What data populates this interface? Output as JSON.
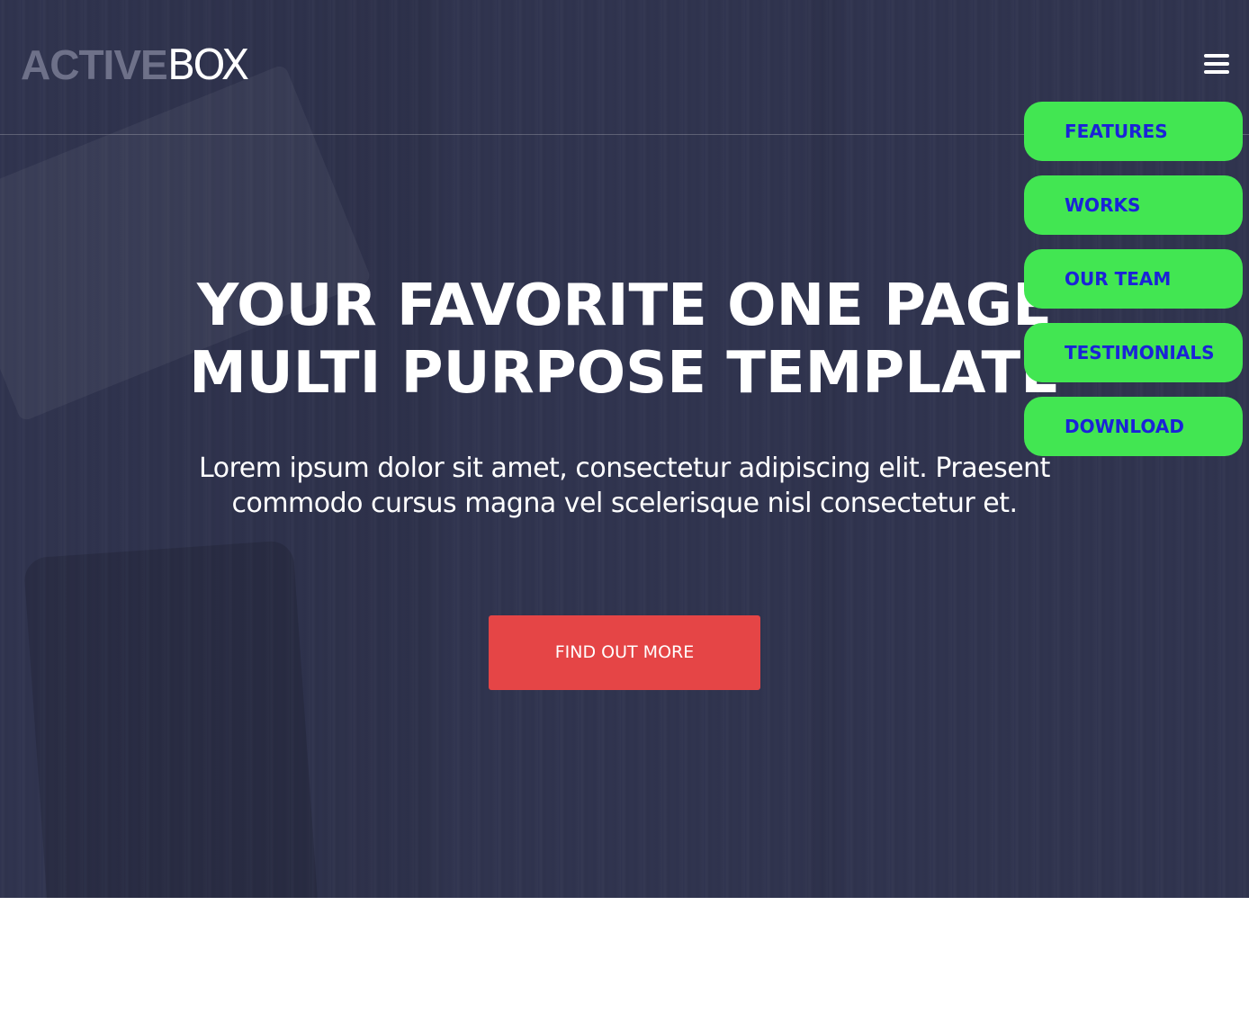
{
  "header": {
    "logo_part1": "ACTIVE",
    "logo_part2": "BOX",
    "menu_icon": "hamburger-menu-icon"
  },
  "menu": {
    "items": [
      {
        "label": "FEATURES"
      },
      {
        "label": "WORKS"
      },
      {
        "label": "OUR TEAM"
      },
      {
        "label": "TESTIMONIALS"
      },
      {
        "label": "DOWNLOAD"
      }
    ]
  },
  "hero": {
    "title_line1": "YOUR FAVORITE ONE PAGE",
    "title_line2": "MULTI PURPOSE TEMPLATE",
    "subtitle_line1": "Lorem ipsum dolor sit amet, consectetur adipiscing elit. Praesent",
    "subtitle_line2": "commodo cursus magna vel scelerisque nisl consectetur et.",
    "cta_label": "FIND OUT MORE"
  },
  "colors": {
    "hero_background": "#30344f",
    "menu_item_background": "#42e652",
    "menu_item_text": "#1a23d8",
    "cta_background": "#e54546",
    "logo_muted": "#6e7189"
  }
}
